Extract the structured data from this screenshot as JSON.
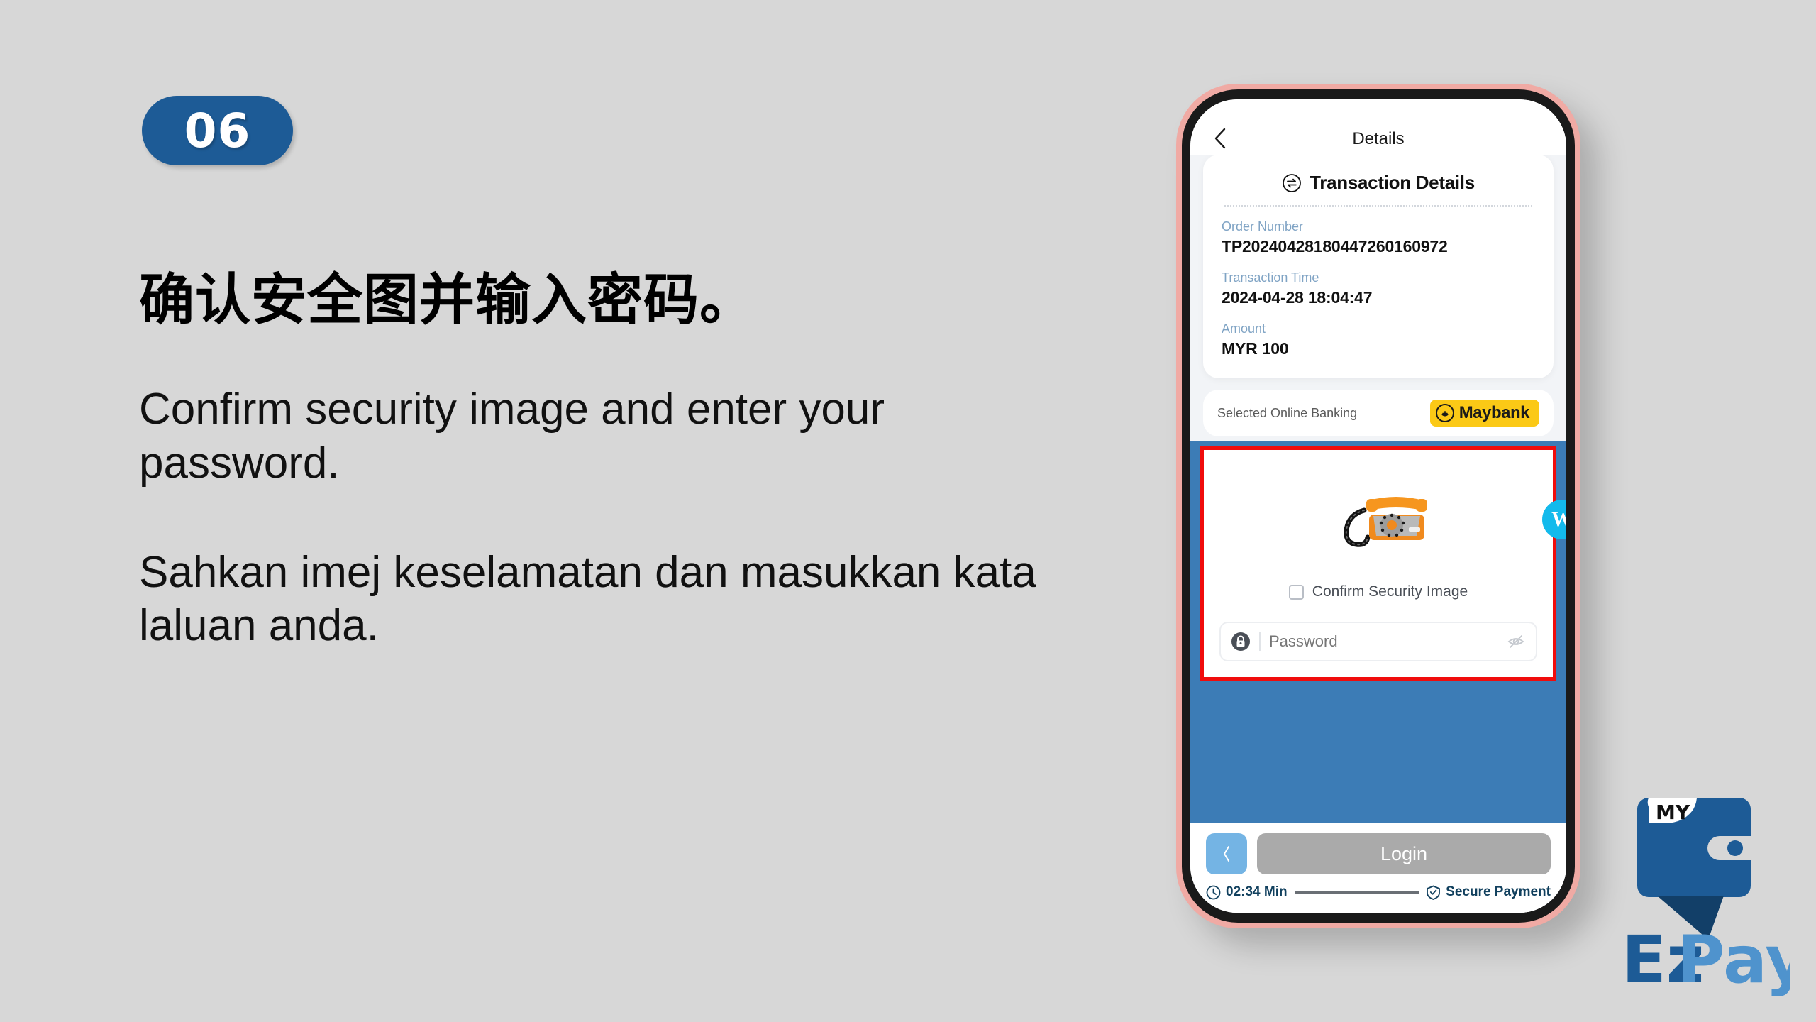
{
  "step": {
    "number": "06"
  },
  "copy": {
    "zh": "确认安全图并输入密码。",
    "en": "Confirm security image and enter your password.",
    "ms": "Sahkan imej keselamatan dan masukkan kata laluan anda."
  },
  "phone": {
    "nav": {
      "title": "Details",
      "back_icon": "chevron-left-icon"
    },
    "transaction_card": {
      "title": "Transaction Details",
      "title_icon": "swap-circle-icon",
      "fields": [
        {
          "label": "Order Number",
          "value": "TP20240428180447260160972"
        },
        {
          "label": "Transaction Time",
          "value": "2024-04-28 18:04:47"
        },
        {
          "label": "Amount",
          "value": "MYR 100"
        }
      ]
    },
    "bank": {
      "label": "Selected Online Banking",
      "name": "Maybank",
      "logo_icon": "maybank-tiger-icon",
      "chip_color": "#fbc916"
    },
    "security": {
      "image_icon": "orange-rotary-telephone-image",
      "confirm_label": "Confirm Security Image",
      "checkbox_checked": "false",
      "password_placeholder": "Password",
      "password_value": "",
      "lock_icon": "lock-icon",
      "eye_icon": "eye-off-icon",
      "highlight_color": "#f00c0c"
    },
    "floating_badge": {
      "label": "W",
      "color": "#13baec"
    },
    "actions": {
      "back_icon": "chevron-left-icon",
      "login_label": "Login"
    },
    "status": {
      "timer": "02:34 Min",
      "timer_icon": "clock-icon",
      "secure_label": "Secure Payment",
      "secure_icon": "shield-check-icon"
    }
  },
  "brand": {
    "wallet_tab": "MY",
    "name_part1": "Ez",
    "name_part2": "Pay",
    "color_dark": "#1d5b96",
    "color_light": "#4f93cd"
  },
  "colors": {
    "background": "#d7d7d7",
    "badge_blue": "#1d5b96",
    "band_blue": "#3c7cb6",
    "label_blue": "#7fa3c4"
  }
}
